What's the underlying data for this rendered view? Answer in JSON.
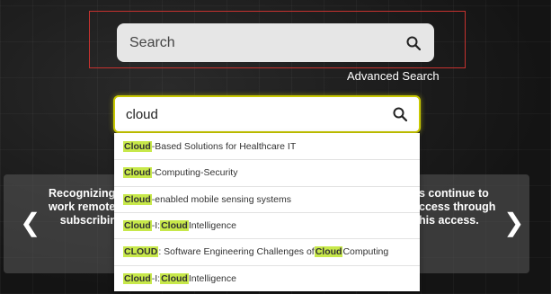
{
  "header": {
    "search_placeholder": "Search",
    "advanced_search": "Advanced Search"
  },
  "main_search": {
    "value": "cloud"
  },
  "suggestions": [
    {
      "hl1": "Cloud",
      "t1": "-Based Solutions for Healthcare IT",
      "hl2": "",
      "t2": ""
    },
    {
      "hl1": "Cloud",
      "t1": "-Computing-Security",
      "hl2": "",
      "t2": ""
    },
    {
      "hl1": "Cloud",
      "t1": "-enabled mobile sensing systems",
      "hl2": "",
      "t2": ""
    },
    {
      "hl1": "Cloud",
      "t1": "-I: ",
      "hl2": "Cloud",
      "t2": " Intelligence"
    },
    {
      "hl1": "CLOUD",
      "t1": ": Software Engineering Challenges of ",
      "hl2": "Cloud",
      "t2": " Computing"
    },
    {
      "hl1": "Cloud",
      "t1": "-I: ",
      "hl2": "Cloud",
      "t2": " Intelligence"
    }
  ],
  "carousel": {
    "left_lines": [
      "Recognizing t",
      "work remotel",
      "subscribin"
    ],
    "right_lines": [
      "s continue to",
      "ccess through",
      "his access."
    ],
    "prev_arrow": "❮",
    "next_arrow": "❯"
  }
}
